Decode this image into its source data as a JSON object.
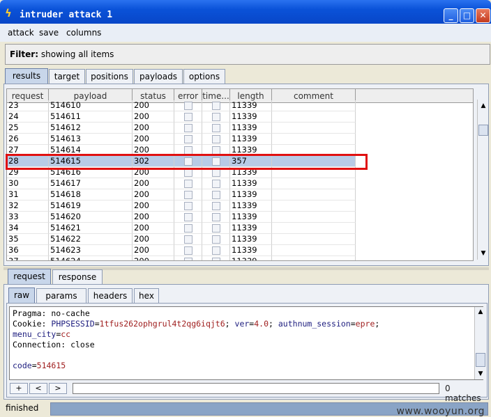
{
  "window": {
    "title": "intruder attack 1",
    "minimize": "_",
    "maximize": "□",
    "close": "✕"
  },
  "menu": [
    "attack",
    "save",
    "columns"
  ],
  "filter": {
    "label": "Filter:",
    "value": "showing all items"
  },
  "top_tabs": [
    "results",
    "target",
    "positions",
    "payloads",
    "options"
  ],
  "columns": [
    "request",
    "payload",
    "status",
    "error",
    "time...",
    "length",
    "comment"
  ],
  "rows": [
    {
      "request": "23",
      "payload": "514610",
      "status": "200",
      "length": "11339"
    },
    {
      "request": "24",
      "payload": "514611",
      "status": "200",
      "length": "11339"
    },
    {
      "request": "25",
      "payload": "514612",
      "status": "200",
      "length": "11339"
    },
    {
      "request": "26",
      "payload": "514613",
      "status": "200",
      "length": "11339"
    },
    {
      "request": "27",
      "payload": "514614",
      "status": "200",
      "length": "11339"
    },
    {
      "request": "28",
      "payload": "514615",
      "status": "302",
      "length": "357"
    },
    {
      "request": "29",
      "payload": "514616",
      "status": "200",
      "length": "11339"
    },
    {
      "request": "30",
      "payload": "514617",
      "status": "200",
      "length": "11339"
    },
    {
      "request": "31",
      "payload": "514618",
      "status": "200",
      "length": "11339"
    },
    {
      "request": "32",
      "payload": "514619",
      "status": "200",
      "length": "11339"
    },
    {
      "request": "33",
      "payload": "514620",
      "status": "200",
      "length": "11339"
    },
    {
      "request": "34",
      "payload": "514621",
      "status": "200",
      "length": "11339"
    },
    {
      "request": "35",
      "payload": "514622",
      "status": "200",
      "length": "11339"
    },
    {
      "request": "36",
      "payload": "514623",
      "status": "200",
      "length": "11339"
    },
    {
      "request": "37",
      "payload": "514624",
      "status": "200",
      "length": "11339"
    }
  ],
  "selected_request": "28",
  "detail_tabs": [
    "request",
    "response"
  ],
  "view_tabs": [
    "raw",
    "params",
    "headers",
    "hex"
  ],
  "request_text": {
    "l1": "Pragma: no-cache",
    "l2a": "Cookie: ",
    "l2b": "PHPSESSID",
    "l2c": "=",
    "l2d": "1tfus262ophgrul4t2qg6iqjt6",
    "l2e": "; ",
    "l2f": "ver",
    "l2g": "=",
    "l2h": "4.0",
    "l2i": "; ",
    "l2j": "authnum_session",
    "l2k": "=",
    "l2l": "epre",
    "l2m": ";",
    "l3a": "menu_city",
    "l3b": "=",
    "l3c": "cc",
    "l4": "Connection: close",
    "l6a": "code",
    "l6b": "=",
    "l6c": "514615"
  },
  "nav": {
    "plus": "+",
    "prev": "<",
    "next": ">"
  },
  "matches": "0 matches",
  "status": "finished",
  "watermark": "www.wooyun.org"
}
